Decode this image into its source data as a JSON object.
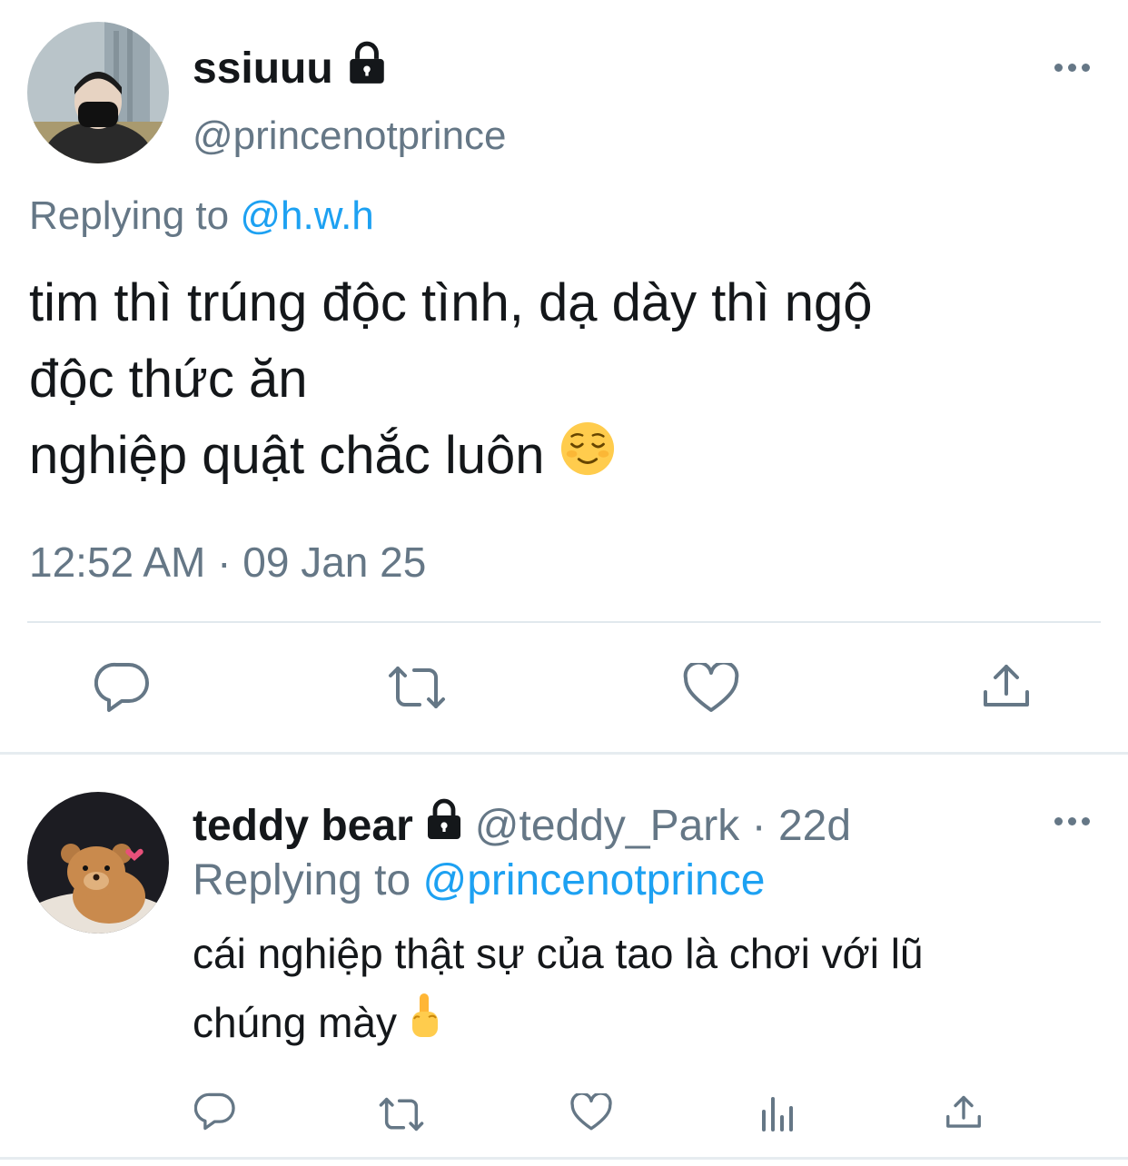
{
  "tweet": {
    "display_name": "ssiuuu",
    "handle": "@princenotprince",
    "replying_prefix": "Replying to ",
    "replying_handle": "@h.w.h",
    "text_lines": [
      "tim thì trúng độc tình, dạ dày thì ngộ",
      "độc thức ăn",
      "nghiệp quật chắc luôn"
    ],
    "emoji": "relieved-face",
    "time": "12:52 AM",
    "separator": " · ",
    "date": "09 Jan 25",
    "actions": [
      "reply-icon",
      "retweet-icon",
      "like-icon",
      "share-icon"
    ]
  },
  "reply": {
    "display_name": "teddy bear",
    "handle": "@teddy_Park",
    "separator": " · ",
    "age": "22d",
    "replying_prefix": "Replying to ",
    "replying_handle": "@princenotprince",
    "text_lines": [
      "cái nghiệp thật sự của tao là chơi với lũ",
      "chúng mày"
    ],
    "emoji": "middle-finger",
    "actions": [
      "reply-icon",
      "retweet-icon",
      "like-icon",
      "analytics-icon",
      "share-icon"
    ]
  },
  "colors": {
    "text": "#14171a",
    "muted": "#657786",
    "link": "#1da1f2",
    "divider": "#e1e8ed"
  }
}
